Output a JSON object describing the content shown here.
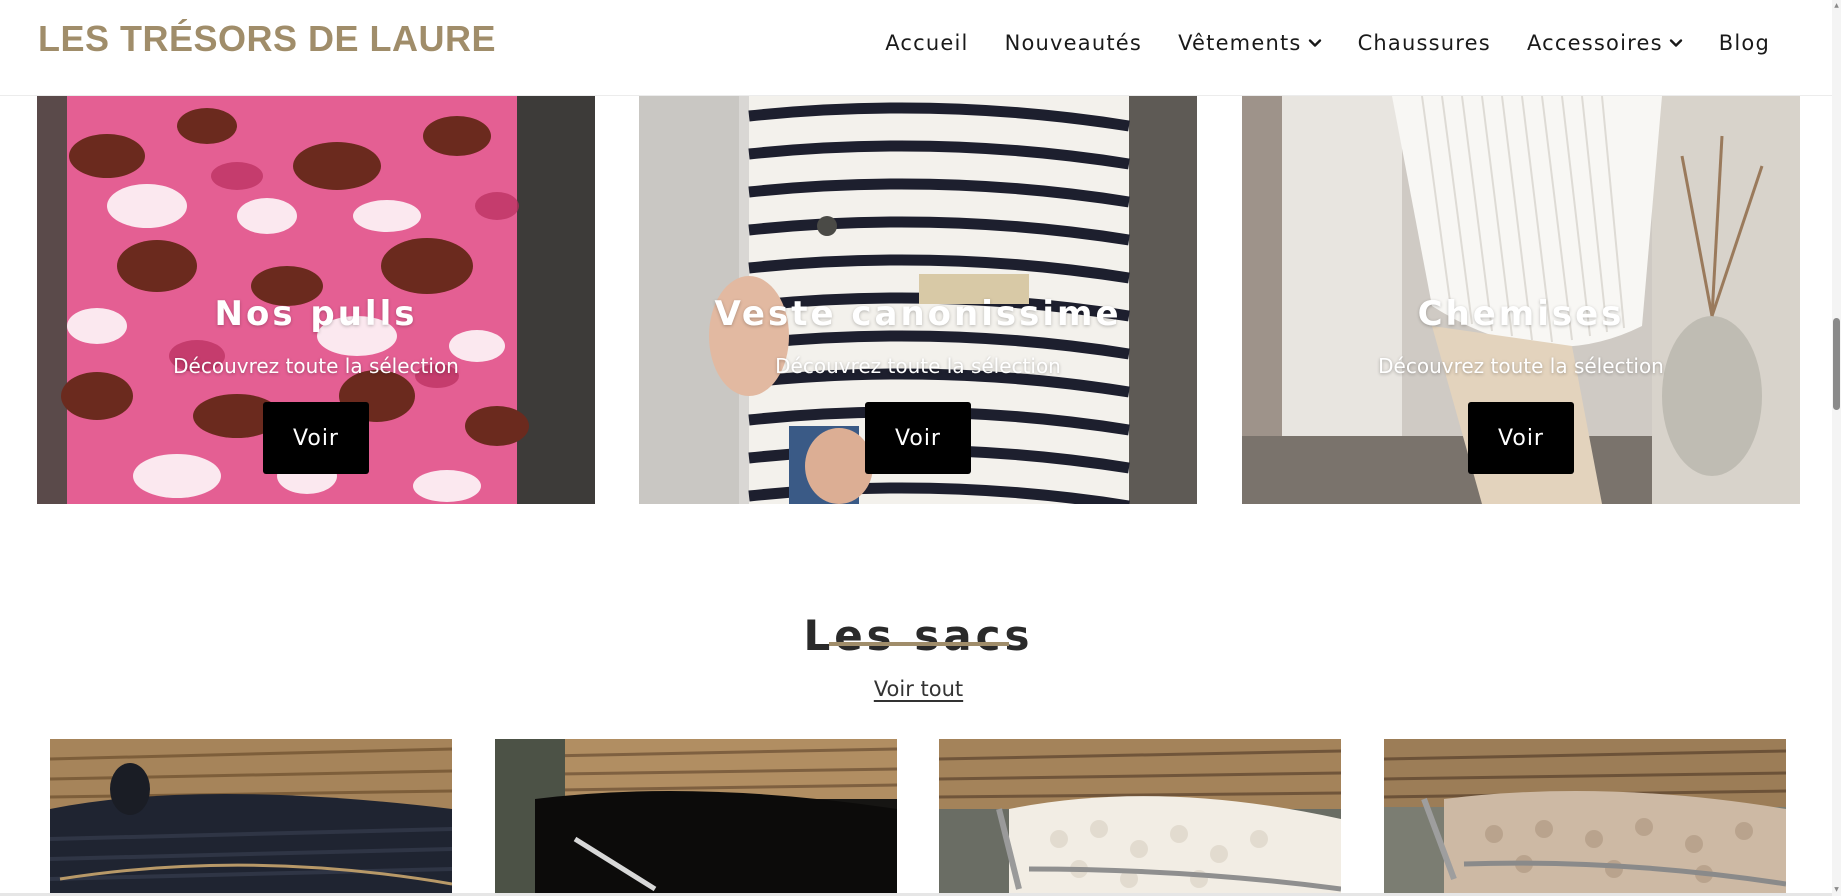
{
  "brand": {
    "logo_text": "LES TRÉSORS DE LAURE",
    "accent_color": "#a08d6a"
  },
  "nav": {
    "items": [
      {
        "label": "Accueil",
        "has_dropdown": false
      },
      {
        "label": "Nouveautés",
        "has_dropdown": false
      },
      {
        "label": "Vêtements",
        "has_dropdown": true
      },
      {
        "label": "Chaussures",
        "has_dropdown": false
      },
      {
        "label": "Accessoires",
        "has_dropdown": true
      },
      {
        "label": "Blog",
        "has_dropdown": false
      }
    ]
  },
  "collections": [
    {
      "title": "Nos pulls",
      "subtitle": "Découvrez toute la sélection",
      "button": "Voir",
      "image": "pink-floral-sweater-photo"
    },
    {
      "title": "Veste canonissime",
      "subtitle": "Découvrez toute la sélection",
      "button": "Voir",
      "image": "striped-jacket-photo"
    },
    {
      "title": "Chemises",
      "subtitle": "Découvrez toute la sélection",
      "button": "Voir",
      "image": "white-pleated-shirt-photo"
    }
  ],
  "bags_section": {
    "title": "Les sacs",
    "view_all": "Voir tout",
    "products": [
      {
        "image": "black-bag-in-wicker-basket-photo"
      },
      {
        "image": "black-fluffy-bag-in-wicker-basket-photo"
      },
      {
        "image": "white-sherpa-bag-in-wicker-basket-photo"
      },
      {
        "image": "beige-sherpa-bag-in-wicker-basket-photo"
      }
    ]
  }
}
